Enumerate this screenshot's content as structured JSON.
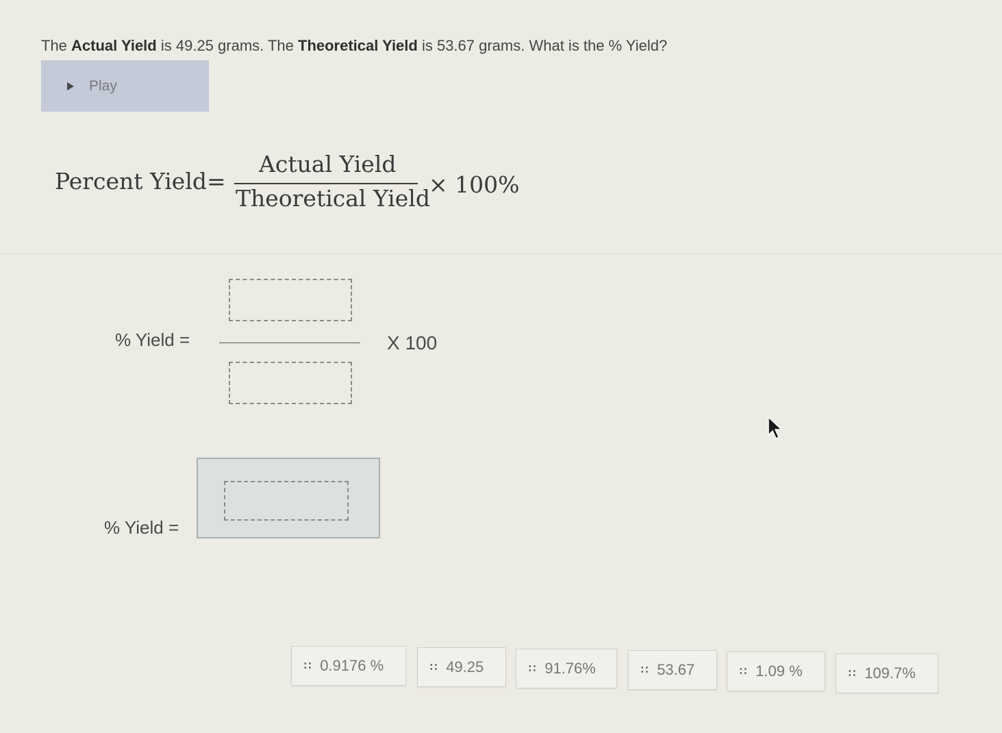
{
  "question": {
    "part1": "The ",
    "actual_bold": "Actual Yield",
    "part2": " is 49.25 grams. The ",
    "theoretical_bold": "Theoretical Yield",
    "part3": " is 53.67 grams. What is the % Yield?"
  },
  "play": {
    "label": "Play",
    "icon": "play-triangle-icon"
  },
  "formula": {
    "lhs": "Percent Yield",
    "eq": "=",
    "numerator": "Actual Yield",
    "denominator": "Theoretical Yield",
    "multiplier": "× 100%"
  },
  "calculation": {
    "label": "% Yield =",
    "times": "X 100"
  },
  "answer": {
    "label": "% Yield ="
  },
  "choices": [
    {
      "label": "0.9176 %"
    },
    {
      "label": "49.25"
    },
    {
      "label": "91.76%"
    },
    {
      "label": "53.67"
    },
    {
      "label": "1.09 %"
    },
    {
      "label": "109.7%"
    }
  ],
  "icons": {
    "drag_handle": "drag-handle-icon",
    "cursor": "mouse-pointer-icon"
  }
}
